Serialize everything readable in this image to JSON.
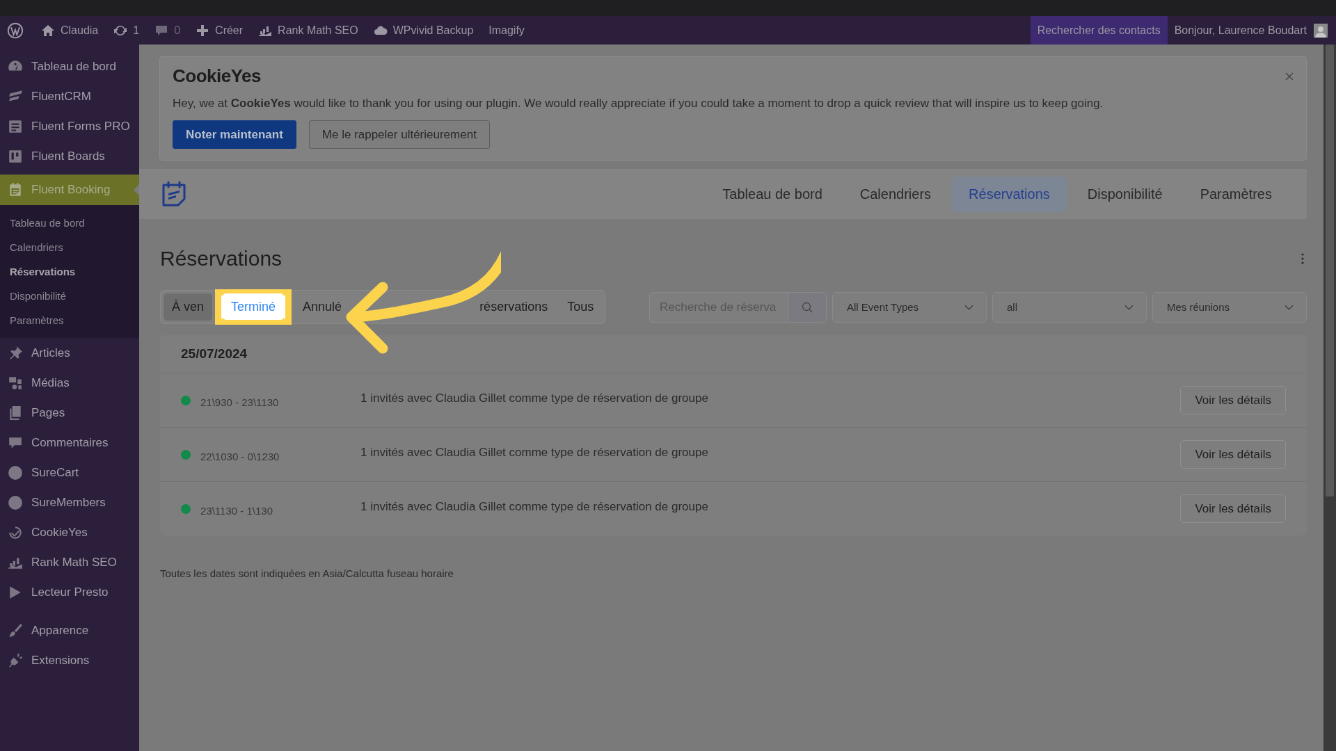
{
  "admin_bar": {
    "items": [
      {
        "label": "Claudia"
      },
      {
        "label": "1"
      },
      {
        "label": "0"
      },
      {
        "label": "Créer"
      },
      {
        "label": "Rank Math SEO"
      },
      {
        "label": "WPvivid Backup"
      },
      {
        "label": "Imagify"
      }
    ],
    "search_contacts": "Rechercher des contacts",
    "greeting": "Bonjour, Laurence Boudart"
  },
  "sidebar": {
    "items": [
      {
        "label": "Tableau de bord",
        "selected": false
      },
      {
        "label": "FluentCRM",
        "selected": false
      },
      {
        "label": "Fluent Forms PRO",
        "selected": false
      },
      {
        "label": "Fluent Boards",
        "selected": false
      },
      {
        "label": "Fluent Booking",
        "selected": true,
        "children": [
          {
            "label": "Tableau de bord",
            "selected": false
          },
          {
            "label": "Calendriers",
            "selected": false
          },
          {
            "label": "Réservations",
            "selected": true
          },
          {
            "label": "Disponibilité",
            "selected": false
          },
          {
            "label": "Paramètres",
            "selected": false
          }
        ]
      },
      {
        "label": "Articles",
        "selected": false
      },
      {
        "label": "Médias",
        "selected": false
      },
      {
        "label": "Pages",
        "selected": false
      },
      {
        "label": "Commentaires",
        "selected": false
      },
      {
        "label": "SureCart",
        "selected": false
      },
      {
        "label": "SureMembers",
        "selected": false
      },
      {
        "label": "CookieYes",
        "selected": false
      },
      {
        "label": "Rank Math SEO",
        "selected": false
      },
      {
        "label": "Lecteur Presto",
        "selected": false
      },
      {
        "label": "Apparence",
        "selected": false
      },
      {
        "label": "Extensions",
        "selected": false
      }
    ]
  },
  "notice": {
    "logo": "CookieYes",
    "message": "Hey, we at **CookieYes** would like to thank you for using our plugin. We would really appreciate if you could take a moment to drop a quick review that will inspire us to keep going.",
    "buttons": [
      {
        "label": "Noter maintenant",
        "kind": "primary"
      },
      {
        "label": "Me le rappeler ultérieurement",
        "kind": "secondary"
      }
    ]
  },
  "app_nav": {
    "tabs": [
      {
        "label": "Tableau de bord",
        "selected": false
      },
      {
        "label": "Calendriers",
        "selected": false
      },
      {
        "label": "Réservations",
        "selected": true
      },
      {
        "label": "Disponibilité",
        "selected": false
      },
      {
        "label": "Paramètres",
        "selected": false
      }
    ]
  },
  "page_title": "Réservations",
  "status_tabs": [
    {
      "label": "À ven",
      "selected": false,
      "focused": true,
      "highlighted": false
    },
    {
      "label": "Terminé",
      "selected": true,
      "focused": false,
      "highlighted": true
    },
    {
      "label": "Annulé",
      "selected": false,
      "focused": false,
      "highlighted": false
    },
    {
      "label": "réservations",
      "selected": false,
      "focused": false,
      "highlighted": false
    },
    {
      "label": "Tous",
      "selected": false,
      "focused": false,
      "highlighted": false
    }
  ],
  "search": {
    "placeholder": "Recherche de réserva"
  },
  "filters": [
    {
      "value": "All Event Types"
    },
    {
      "value": "all"
    },
    {
      "value": "Mes réunions"
    }
  ],
  "date_group": {
    "date": "25/07/2024",
    "bookings": [
      {
        "time": "21\\930 - 23\\1130",
        "description": "1 invités avec Claudia Gillet comme type de réservation de groupe",
        "action": "Voir les détails",
        "color": "#138a4a"
      },
      {
        "time": "22\\1030 - 0\\1230",
        "description": "1 invités avec Claudia Gillet comme type de réservation de groupe",
        "action": "Voir les détails",
        "color": "#138a4a"
      },
      {
        "time": "23\\1130 - 1\\130",
        "description": "1 invités avec Claudia Gillet comme type de réservation de groupe",
        "action": "Voir les détails",
        "color": "#138a4a"
      }
    ]
  },
  "footnote": "Toutes les dates sont indiquées en Asia/Calcutta fuseau horaire"
}
